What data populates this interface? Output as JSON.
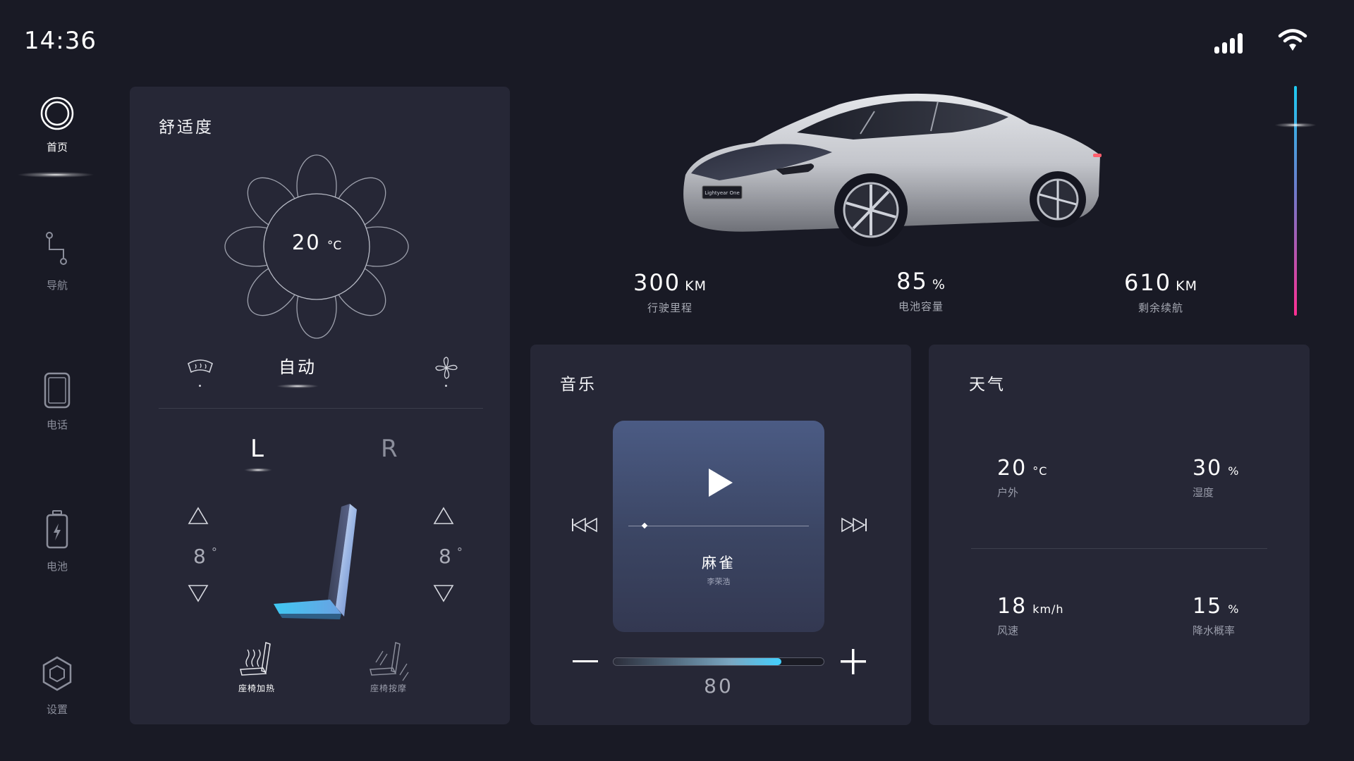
{
  "status": {
    "time": "14:36"
  },
  "sidebar": {
    "items": [
      {
        "label": "首页",
        "icon": "home-icon",
        "active": true
      },
      {
        "label": "导航",
        "icon": "navigation-icon",
        "active": false
      },
      {
        "label": "电话",
        "icon": "phone-icon",
        "active": false
      },
      {
        "label": "电池",
        "icon": "battery-icon",
        "active": false
      },
      {
        "label": "设置",
        "icon": "settings-icon",
        "active": false
      }
    ]
  },
  "comfort": {
    "title": "舒适度",
    "temperature": "20",
    "temp_unit": "°C",
    "mode_label": "自动",
    "mode_icons": [
      "windshield-defrost-icon",
      "fan-icon"
    ],
    "seat_left": "L",
    "seat_right": "R",
    "left_value": "8",
    "right_value": "8",
    "degree": "°",
    "seat_heat_label": "座椅加热",
    "seat_massage_label": "座椅按摩"
  },
  "car": {
    "stats": [
      {
        "value": "300",
        "unit": "KM",
        "label": "行驶里程"
      },
      {
        "value": "85",
        "unit": "%",
        "label": "电池容量"
      },
      {
        "value": "610",
        "unit": "KM",
        "label": "剩余续航"
      }
    ],
    "badge": "Lightyear One",
    "range_colors": [
      "#1ecbf2",
      "#ff2f92"
    ]
  },
  "music": {
    "title": "音乐",
    "song": "麻雀",
    "artist": "李荣浩",
    "progress": 0.09,
    "volume": 80,
    "volume_text": "80"
  },
  "weather": {
    "title": "天气",
    "items": [
      {
        "value": "20",
        "unit": "°C",
        "label": "户外"
      },
      {
        "value": "30",
        "unit": "%",
        "label": "湿度"
      },
      {
        "value": "18",
        "unit": "km/h",
        "label": "风速"
      },
      {
        "value": "15",
        "unit": "%",
        "label": "降水概率"
      }
    ]
  }
}
